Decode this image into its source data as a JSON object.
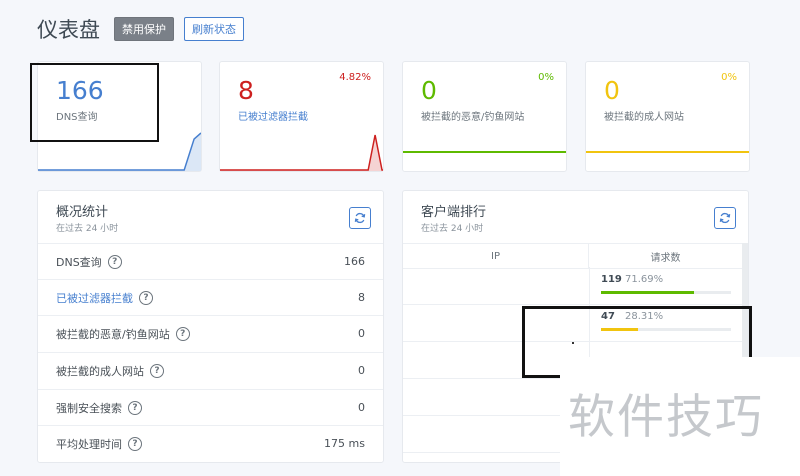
{
  "header": {
    "title": "仪表盘",
    "disable_protection": "禁用保护",
    "refresh_status": "刷新状态"
  },
  "stats": [
    {
      "value": "166",
      "label": "DNS查询",
      "percent": "",
      "color": "#467fcf"
    },
    {
      "value": "8",
      "label": "已被过滤器拦截",
      "percent": "4.82%",
      "color": "#cd201f"
    },
    {
      "value": "0",
      "label": "被拦截的恶意/钓鱼网站",
      "percent": "0%",
      "color": "#5eba00"
    },
    {
      "value": "0",
      "label": "被拦截的成人网站",
      "percent": "0%",
      "color": "#f1c40f"
    }
  ],
  "overview": {
    "title": "概况统计",
    "subtitle": "在过去 24 小时",
    "rows": [
      {
        "label": "DNS查询",
        "value": "166"
      },
      {
        "label": "已被过滤器拦截",
        "value": "8"
      },
      {
        "label": "被拦截的恶意/钓鱼网站",
        "value": "0"
      },
      {
        "label": "被拦截的成人网站",
        "value": "0"
      },
      {
        "label": "强制安全搜索",
        "value": "0"
      },
      {
        "label": "平均处理时间",
        "value": "175 ms"
      }
    ]
  },
  "clients": {
    "title": "客户端排行",
    "subtitle": "在过去 24 小时",
    "col_ip": "IP",
    "col_requests": "请求数",
    "rows": [
      {
        "ip": "",
        "requests": "119",
        "percent": "71.69%",
        "fill": 0.7169,
        "color": "#5eba00"
      },
      {
        "ip": "",
        "requests": "47",
        "percent": "28.31%",
        "fill": 0.2831,
        "color": "#f1c40f"
      }
    ]
  },
  "watermark": "软件技巧"
}
